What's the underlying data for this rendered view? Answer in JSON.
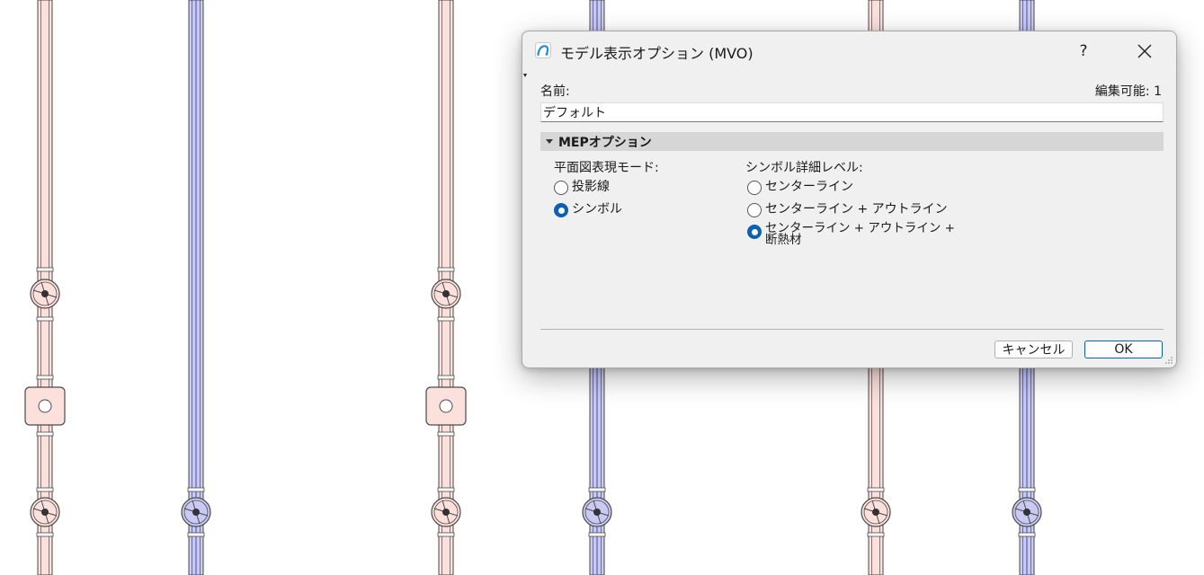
{
  "dialog": {
    "title": "モデル表示オプション (MVO)",
    "help_label": "?",
    "name_label": "名前:",
    "editable_label": "編集可能: 1",
    "name_value": "デフォルト",
    "section_title": "MEPオプション",
    "plan_mode": {
      "label": "平面図表現モード:",
      "options": [
        {
          "label": "投影線",
          "checked": false
        },
        {
          "label": "シンボル",
          "checked": true
        }
      ]
    },
    "symbol_detail": {
      "label": "シンボル詳細レベル:",
      "options": [
        {
          "label": "センターライン",
          "checked": false
        },
        {
          "label": "センターライン + アウトライン",
          "checked": false
        },
        {
          "label": "センターライン + アウトライン + 断熱材",
          "checked": true
        }
      ]
    },
    "cancel_label": "キャンセル",
    "ok_label": "OK"
  },
  "colors": {
    "supply_pipe": "#fbe0dc",
    "return_pipe": "#c9caf4",
    "accent": "#0b5fb4"
  }
}
